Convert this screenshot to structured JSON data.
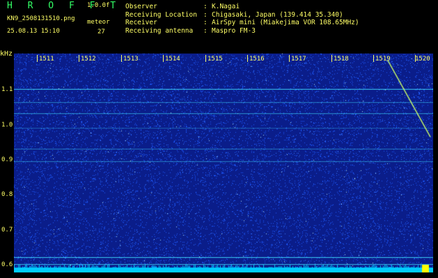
{
  "header": {
    "logo": "H R O F F T",
    "version": "1.0.0f",
    "filename": "KN9_2508131510.png",
    "mode": "meteor",
    "datetime": "25.08.13 15:10",
    "count": "27",
    "info": [
      {
        "key": "Observer",
        "value": "K.Nagai"
      },
      {
        "key": "Receiving Location",
        "value": "Chigasaki, Japan (139.414 35.340)"
      },
      {
        "key": "Receiver",
        "value": "AirSpy mini (Miakejima VOR 108.65MHz)"
      },
      {
        "key": "Receiving antenna",
        "value": "Maspro FM-3"
      }
    ]
  },
  "axes": {
    "y_unit": "kHz",
    "y_ticks": [
      "1.1",
      "1.0",
      "0.9",
      "0.8",
      "0.7",
      "0.6"
    ],
    "x_ticks": [
      "1511",
      "1512",
      "1513",
      "1514",
      "1515",
      "1516",
      "1517",
      "1518",
      "1519",
      "1520"
    ]
  },
  "colors": {
    "background": "#0a1d8a",
    "noise": "#1e5aff",
    "trace": "#40e0ff",
    "text": "#ffff66",
    "logo": "#33ff66",
    "meteor_trail": "#ccff66",
    "level_bar": "#00ccff"
  }
}
